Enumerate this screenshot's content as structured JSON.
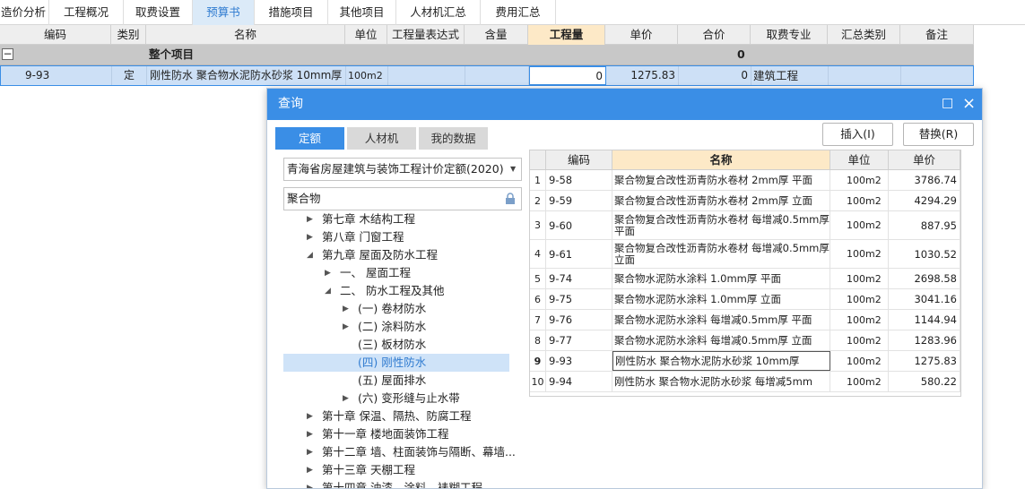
{
  "top_tabs": [
    "造价分析",
    "工程概况",
    "取费设置",
    "预算书",
    "措施项目",
    "其他项目",
    "人材机汇总",
    "费用汇总"
  ],
  "active_top_tab": 3,
  "main_headers": [
    "编码",
    "类别",
    "名称",
    "单位",
    "工程量表达式",
    "含量",
    "工程量",
    "单价",
    "合价",
    "取费专业",
    "汇总类别",
    "备注"
  ],
  "summary_row": {
    "toggle": "−",
    "name": "整个项目",
    "total": "0"
  },
  "item_row": {
    "code": "9-93",
    "category": "定",
    "name": "刚性防水 聚合物水泥防水砂浆 10mm厚",
    "unit": "100m2",
    "quantity": "0",
    "unit_price": "1275.83",
    "total": "0",
    "specialty": "建筑工程"
  },
  "dialog": {
    "title": "查询",
    "maximize_icon": "□",
    "close_icon": "×",
    "tabs": [
      "定额",
      "人材机",
      "我的数据"
    ],
    "active_tab": 0,
    "insert_button": "插入(I)",
    "replace_button": "替换(R)",
    "quota_library": "青海省房屋建筑与装饰工程计价定额(2020)",
    "search_value": "聚合物",
    "tree": [
      {
        "label": "第七章 木结构工程",
        "arrow": "▶"
      },
      {
        "label": "第八章 门窗工程",
        "arrow": "▶"
      },
      {
        "label": "第九章 屋面及防水工程",
        "arrow": "◢"
      },
      {
        "label": "一、 屋面工程",
        "arrow": "▶"
      },
      {
        "label": "二、 防水工程及其他",
        "arrow": "◢"
      },
      {
        "label": "(一) 卷材防水",
        "arrow": "▶"
      },
      {
        "label": "(二) 涂料防水",
        "arrow": "▶"
      },
      {
        "label": "(三) 板材防水",
        "arrow": ""
      },
      {
        "label": "(四) 刚性防水",
        "arrow": ""
      },
      {
        "label": "(五) 屋面排水",
        "arrow": ""
      },
      {
        "label": "(六) 变形缝与止水带",
        "arrow": "▶"
      },
      {
        "label": "第十章 保温、隔热、防腐工程",
        "arrow": "▶"
      },
      {
        "label": "第十一章 楼地面装饰工程",
        "arrow": "▶"
      },
      {
        "label": "第十二章 墙、柱面装饰与隔断、幕墙...",
        "arrow": "▶"
      },
      {
        "label": "第十三章 天棚工程",
        "arrow": "▶"
      },
      {
        "label": "第十四章 油漆、涂料、裱糊工程",
        "arrow": "▶"
      }
    ],
    "selected_tree_index": 8,
    "table_headers": [
      "",
      "编码",
      "名称",
      "单位",
      "单价"
    ],
    "table_rows": [
      {
        "no": "1",
        "code": "9-58",
        "name": "聚合物复合改性沥青防水卷材 2mm厚 平面",
        "unit": "100m2",
        "price": "3786.74"
      },
      {
        "no": "2",
        "code": "9-59",
        "name": "聚合物复合改性沥青防水卷材 2mm厚 立面",
        "unit": "100m2",
        "price": "4294.29"
      },
      {
        "no": "3",
        "code": "9-60",
        "name": "聚合物复合改性沥青防水卷材 每增减0.5mm厚 平面",
        "unit": "100m2",
        "price": "887.95"
      },
      {
        "no": "4",
        "code": "9-61",
        "name": "聚合物复合改性沥青防水卷材 每增减0.5mm厚 立面",
        "unit": "100m2",
        "price": "1030.52"
      },
      {
        "no": "5",
        "code": "9-74",
        "name": "聚合物水泥防水涂料 1.0mm厚 平面",
        "unit": "100m2",
        "price": "2698.58"
      },
      {
        "no": "6",
        "code": "9-75",
        "name": "聚合物水泥防水涂料 1.0mm厚 立面",
        "unit": "100m2",
        "price": "3041.16"
      },
      {
        "no": "7",
        "code": "9-76",
        "name": "聚合物水泥防水涂料 每增减0.5mm厚 平面",
        "unit": "100m2",
        "price": "1144.94"
      },
      {
        "no": "8",
        "code": "9-77",
        "name": "聚合物水泥防水涂料 每增减0.5mm厚 立面",
        "unit": "100m2",
        "price": "1283.96"
      },
      {
        "no": "9",
        "code": "9-93",
        "name": "刚性防水 聚合物水泥防水砂浆 10mm厚",
        "unit": "100m2",
        "price": "1275.83"
      },
      {
        "no": "10",
        "code": "9-94",
        "name": "刚性防水 聚合物水泥防水砂浆 每增减5mm",
        "unit": "100m2",
        "price": "580.22"
      }
    ],
    "selected_row": 8
  },
  "colors": {
    "accent": "#3a8ee6",
    "header_highlight": "#fde9c7",
    "selection": "#cfe3f8"
  }
}
